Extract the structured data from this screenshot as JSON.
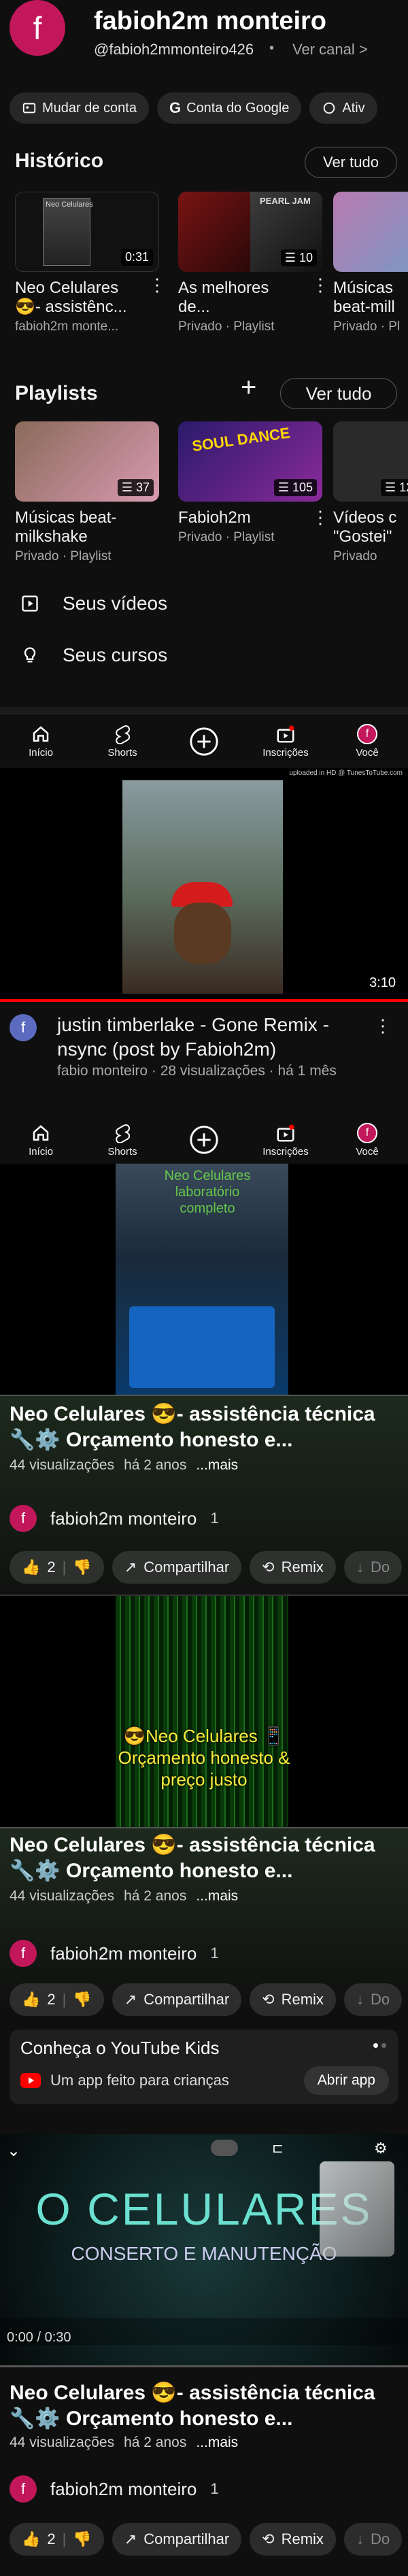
{
  "profile": {
    "avatar_letter": "f",
    "name": "fabioh2m monteiro",
    "handle": "@fabioh2mmonteiro426",
    "separator": "•",
    "view_channel": "Ver canal >"
  },
  "chips": [
    "Mudar de conta",
    "Conta do Google",
    "Ativ"
  ],
  "history": {
    "title": "Histórico",
    "see_all": "Ver tudo",
    "items": [
      {
        "title": "Neo Celulares 😎- assistênc...",
        "sub": "fabioh2m monte...",
        "badge": "0:31",
        "thumb_text": "Neo Celulares"
      },
      {
        "title": "As melhores de...",
        "sub": "Privado · Playlist",
        "badge": "10",
        "thumb_text": "PEARL JAM"
      },
      {
        "title": "Músicas beat-mill",
        "sub": "Privado · Pl",
        "badge": ""
      }
    ]
  },
  "playlists": {
    "title": "Playlists",
    "plus": "+",
    "see_all": "Ver tudo",
    "items": [
      {
        "title": "Músicas beat-milkshake",
        "sub": "Privado · Playlist",
        "badge": "37"
      },
      {
        "title": "Fabioh2m",
        "sub": "Privado · Playlist",
        "badge": "105",
        "thumb_text": "SOUL DANCE"
      },
      {
        "title": "Vídeos c \"Gostei\"",
        "sub": "Privado",
        "badge": "12"
      }
    ]
  },
  "list": [
    {
      "label": "Seus vídeos"
    },
    {
      "label": "Seus cursos"
    }
  ],
  "nav": {
    "home": "Início",
    "shorts": "Shorts",
    "subs": "Inscrições",
    "you": "Você",
    "you_letter": "f"
  },
  "video1": {
    "uploaded": "uploaded in HD @ TunesToTube.com",
    "duration": "3:10",
    "title": "justin timberlake - Gone Remix - nsync (post by Fabioh2m)",
    "meta": "fabio monteiro · 28 visualizações · há 1 mês",
    "avatar_letter": "f"
  },
  "shorts": [
    {
      "overlay": "Neo Celulares laboratório completo",
      "title": "Neo Celulares 😎- assistência técnica 🔧⚙️ Orçamento honesto e...",
      "views": "44 visualizações",
      "age": "há 2 anos",
      "more": "...mais",
      "channel": "fabioh2m monteiro",
      "subs": "1",
      "likes": "2",
      "share": "Compartilhar",
      "remix": "Remix",
      "download": "Do"
    },
    {
      "overlay": "😎Neo Celulares 📱 Orçamento honesto & preço justo",
      "title": "Neo Celulares 😎- assistência técnica 🔧⚙️ Orçamento honesto e...",
      "views": "44 visualizações",
      "age": "há 2 anos",
      "more": "...mais",
      "channel": "fabioh2m monteiro",
      "subs": "1",
      "likes": "2",
      "share": "Compartilhar",
      "remix": "Remix",
      "download": "Do"
    },
    {
      "overlay": "O CELULARES",
      "overlay_sub": "CONSERTO E MANUTENÇÃO",
      "time": "0:00 / 0:30",
      "title": "Neo Celulares 😎- assistência técnica 🔧⚙️ Orçamento honesto e...",
      "views": "44 visualizações",
      "age": "há 2 anos",
      "more": "...mais",
      "channel": "fabioh2m monteiro",
      "subs": "1",
      "likes": "2",
      "share": "Compartilhar",
      "remix": "Remix",
      "download": "Do"
    }
  ],
  "kids_promo": {
    "title": "Conheça o YouTube Kids",
    "text": "Um app feito para crianças",
    "button": "Abrir app"
  },
  "colors": {
    "bg": "#0f0f0f",
    "accent": "#ff0000",
    "avatar": "#c2185b",
    "green_bg": "#1e2d1e"
  }
}
